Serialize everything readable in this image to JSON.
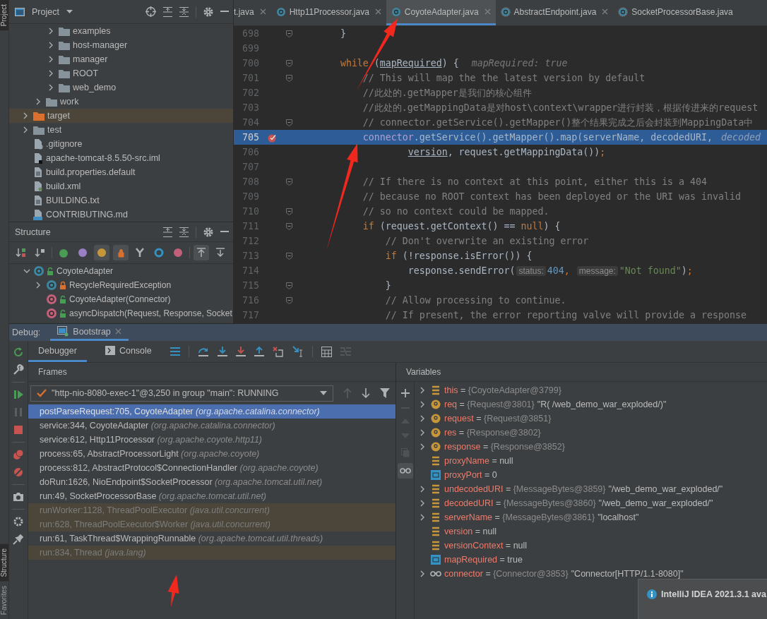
{
  "tool_stripes": {
    "top": [
      {
        "label": "Project",
        "selected": true
      }
    ],
    "bottom": [
      {
        "label": "Structure",
        "selected": true
      },
      {
        "label": "Favorites",
        "selected": false
      }
    ]
  },
  "project_panel": {
    "title": "Project",
    "tree": [
      {
        "children": [
          {
            "children": [
              {
                "label": "examples",
                "kind": "folder",
                "expanded": false,
                "selected": false
              },
              {
                "label": "host-manager",
                "kind": "folder",
                "expanded": false,
                "selected": false
              },
              {
                "label": "manager",
                "kind": "folder",
                "expanded": false,
                "selected": false
              },
              {
                "label": "ROOT",
                "kind": "folder",
                "expanded": false,
                "selected": false
              },
              {
                "label": "web_demo",
                "kind": "folder",
                "expanded": false,
                "selected": false
              }
            ]
          },
          {
            "label": "work",
            "kind": "folder",
            "expanded": false,
            "selected": false
          }
        ]
      },
      {
        "label": "target",
        "kind": "excluded-folder",
        "expanded": false,
        "selected": true
      },
      {
        "label": "test",
        "kind": "folder",
        "expanded": false,
        "selected": false
      },
      {
        "label": ".gitignore",
        "kind": "ignore-file",
        "selected": false
      },
      {
        "label": "apache-tomcat-8.5.50-src.iml",
        "kind": "module-file",
        "selected": false
      },
      {
        "label": "build.properties.default",
        "kind": "text-file",
        "selected": false
      },
      {
        "label": "build.xml",
        "kind": "xml-file",
        "selected": false
      },
      {
        "label": "BUILDING.txt",
        "kind": "text-file",
        "selected": false
      },
      {
        "label": "CONTRIBUTING.md",
        "kind": "markdown-file",
        "selected": false
      }
    ]
  },
  "structure_panel": {
    "title": "Structure",
    "toolbar": [
      {
        "kind": "sort-visibility",
        "on": false
      },
      {
        "kind": "sort-alpha",
        "on": false
      },
      {
        "kind": "inherited",
        "on": false
      },
      {
        "kind": "properties",
        "on": false
      },
      {
        "kind": "fields",
        "on": true
      },
      {
        "kind": "non-public",
        "on": true
      },
      {
        "kind": "fork",
        "on": false
      },
      {
        "kind": "anonymous",
        "on": false
      },
      {
        "kind": "lambdas",
        "on": false
      },
      {
        "kind": "autoscroll-to",
        "on": true
      },
      {
        "kind": "autoscroll-from",
        "on": false
      }
    ],
    "tree": [
      {
        "label": "CoyoteAdapter",
        "kind": "class",
        "private": false,
        "expanded": true,
        "children": [
          {
            "label": "RecycleRequiredException",
            "kind": "class",
            "private": true,
            "expanded": false
          },
          {
            "label": "CoyoteAdapter(Connector)",
            "kind": "method",
            "private": false
          },
          {
            "label": "asyncDispatch(Request, Response, Socket",
            "kind": "method",
            "private": false
          }
        ]
      }
    ]
  },
  "editor": {
    "tabs": [
      {
        "label": "t.java",
        "selected": false,
        "closable": true
      },
      {
        "label": "Http11Processor.java",
        "selected": false,
        "closable": true,
        "kind": "class"
      },
      {
        "label": "CoyoteAdapter.java",
        "selected": true,
        "closable": true,
        "kind": "class"
      },
      {
        "label": "AbstractEndpoint.java",
        "selected": false,
        "closable": true,
        "kind": "abstract-class"
      },
      {
        "label": "SocketProcessorBase.java",
        "selected": false,
        "closable": false,
        "kind": "abstract-class"
      }
    ],
    "lines": [
      {
        "number": "698",
        "fold": true,
        "breakpoint": false,
        "current": false,
        "tokens": [
          {
            "kind": "plain",
            "text": "        }"
          }
        ]
      },
      {
        "number": "699",
        "fold": false,
        "breakpoint": false,
        "current": false
      },
      {
        "number": "700",
        "fold": true,
        "breakpoint": false,
        "current": false,
        "tokens": [
          {
            "kind": "kw",
            "text": "        while"
          },
          {
            "kind": "plain",
            "text": " ("
          },
          {
            "kind": "var",
            "text": "mapRequired"
          },
          {
            "kind": "plain",
            "text": ") {"
          },
          {
            "kind": "inline",
            "text": "mapRequired: true"
          }
        ]
      },
      {
        "number": "701",
        "fold": true,
        "breakpoint": false,
        "current": false,
        "tokens": [
          {
            "kind": "comment",
            "text": "            // This will map the the latest version by default"
          }
        ]
      },
      {
        "number": "702",
        "fold": false,
        "breakpoint": false,
        "current": false,
        "tokens": [
          {
            "kind": "comment",
            "text": "            //此处的.getMapper是我们的核心组件"
          }
        ]
      },
      {
        "number": "703",
        "fold": false,
        "breakpoint": false,
        "current": false,
        "tokens": [
          {
            "kind": "comment",
            "text": "            //此处的.getMappingData是对host\\context\\wrapper进行封装，根据传进来的request"
          }
        ]
      },
      {
        "number": "704",
        "fold": true,
        "breakpoint": false,
        "current": false,
        "tokens": [
          {
            "kind": "comment",
            "text": "            // connector.getService().getMapper()整个结果完成之后会封装到MappingData中"
          }
        ]
      },
      {
        "number": "705",
        "fold": false,
        "breakpoint": true,
        "current": true,
        "tokens": [
          {
            "kind": "field",
            "text": "            connector"
          },
          {
            "kind": "plain",
            "text": ".getService().getMapper().map(serverName, decodedURI,"
          },
          {
            "kind": "inline",
            "text": "decoded"
          }
        ]
      },
      {
        "number": "706",
        "fold": false,
        "breakpoint": false,
        "current": false,
        "tokens": [
          {
            "kind": "var",
            "text": "                    version"
          },
          {
            "kind": "plain",
            "text": ", request.getMappingData())"
          },
          {
            "kind": "punct",
            "text": ";"
          }
        ]
      },
      {
        "number": "707",
        "fold": false,
        "breakpoint": false,
        "current": false
      },
      {
        "number": "708",
        "fold": true,
        "breakpoint": false,
        "current": false,
        "tokens": [
          {
            "kind": "comment",
            "text": "            // If there is no context at this point, either this is a 404"
          }
        ]
      },
      {
        "number": "709",
        "fold": false,
        "breakpoint": false,
        "current": false,
        "tokens": [
          {
            "kind": "comment",
            "text": "            // because no ROOT context has been deployed or the URI was invalid"
          }
        ]
      },
      {
        "number": "710",
        "fold": true,
        "breakpoint": false,
        "current": false,
        "tokens": [
          {
            "kind": "comment",
            "text": "            // so no context could be mapped."
          }
        ]
      },
      {
        "number": "711",
        "fold": true,
        "breakpoint": false,
        "current": false,
        "tokens": [
          {
            "kind": "kw",
            "text": "            if"
          },
          {
            "kind": "plain",
            "text": " (request.getContext() == "
          },
          {
            "kind": "kw",
            "text": "null"
          },
          {
            "kind": "plain",
            "text": ") {"
          }
        ]
      },
      {
        "number": "712",
        "fold": false,
        "breakpoint": false,
        "current": false,
        "tokens": [
          {
            "kind": "comment",
            "text": "                // Don't overwrite an existing error"
          }
        ]
      },
      {
        "number": "713",
        "fold": true,
        "breakpoint": false,
        "current": false,
        "tokens": [
          {
            "kind": "kw",
            "text": "                if"
          },
          {
            "kind": "plain",
            "text": " (!response.isError()) {"
          }
        ]
      },
      {
        "number": "714",
        "fold": false,
        "breakpoint": false,
        "current": false,
        "tokens": [
          {
            "kind": "plain",
            "text": "                    response.sendError("
          },
          {
            "kind": "hint",
            "text": "status:"
          },
          {
            "kind": "num",
            "text": "404"
          },
          {
            "kind": "punct",
            "text": ", "
          },
          {
            "kind": "hint",
            "text": "message:"
          },
          {
            "kind": "str",
            "text": "\"Not found\""
          },
          {
            "kind": "plain",
            "text": ")"
          },
          {
            "kind": "punct",
            "text": ";"
          }
        ]
      },
      {
        "number": "715",
        "fold": true,
        "breakpoint": false,
        "current": false,
        "tokens": [
          {
            "kind": "plain",
            "text": "                }"
          }
        ]
      },
      {
        "number": "716",
        "fold": true,
        "breakpoint": false,
        "current": false,
        "tokens": [
          {
            "kind": "comment",
            "text": "                // Allow processing to continue."
          }
        ]
      },
      {
        "number": "717",
        "fold": false,
        "breakpoint": false,
        "current": false,
        "tokens": [
          {
            "kind": "comment",
            "text": "                // If present, the error reporting valve will provide a response"
          }
        ]
      }
    ]
  },
  "debug": {
    "title": "Debug:",
    "session": "Bootstrap",
    "tabs": [
      {
        "label": "Debugger",
        "selected": true,
        "kind": "debugger"
      },
      {
        "label": "Console",
        "selected": false,
        "kind": "console"
      }
    ],
    "frames": {
      "title": "Frames",
      "thread": "\"http-nio-8080-exec-1\"@3,250 in group \"main\": RUNNING",
      "items": [
        {
          "method": "postParseRequest:705, CoyoteAdapter",
          "package": "(org.apache.catalina.connector)",
          "selected": true,
          "library": false
        },
        {
          "method": "service:344, CoyoteAdapter",
          "package": "(org.apache.catalina.connector)",
          "selected": false,
          "library": false
        },
        {
          "method": "service:612, Http11Processor",
          "package": "(org.apache.coyote.http11)",
          "selected": false,
          "library": false
        },
        {
          "method": "process:65, AbstractProcessorLight",
          "package": "(org.apache.coyote)",
          "selected": false,
          "library": false
        },
        {
          "method": "process:812, AbstractProtocol$ConnectionHandler",
          "package": "(org.apache.coyote)",
          "selected": false,
          "library": false
        },
        {
          "method": "doRun:1626, NioEndpoint$SocketProcessor",
          "package": "(org.apache.tomcat.util.net)",
          "selected": false,
          "library": false
        },
        {
          "method": "run:49, SocketProcessorBase",
          "package": "(org.apache.tomcat.util.net)",
          "selected": false,
          "library": false
        },
        {
          "method": "runWorker:1128, ThreadPoolExecutor",
          "package": "(java.util.concurrent)",
          "selected": false,
          "library": true
        },
        {
          "method": "run:628, ThreadPoolExecutor$Worker",
          "package": "(java.util.concurrent)",
          "selected": false,
          "library": true
        },
        {
          "method": "run:61, TaskThread$WrappingRunnable",
          "package": "(org.apache.tomcat.util.threads)",
          "selected": false,
          "library": false
        },
        {
          "method": "run:834, Thread",
          "package": "(java.lang)",
          "selected": false,
          "library": true
        }
      ]
    },
    "variables": {
      "title": "Variables",
      "items": [
        {
          "name": "this",
          "op": "=",
          "ref": "{CoyoteAdapter@3799}",
          "kind": "field",
          "has_children": true
        },
        {
          "name": "req",
          "op": "=",
          "ref": "{Request@3801}",
          "value": "\"R( /web_demo_war_exploded/)\"",
          "kind": "param",
          "has_children": true
        },
        {
          "name": "request",
          "op": "=",
          "ref": "{Request@3851}",
          "kind": "param",
          "has_children": true
        },
        {
          "name": "res",
          "op": "=",
          "ref": "{Response@3802}",
          "kind": "param",
          "has_children": true
        },
        {
          "name": "response",
          "op": "=",
          "ref": "{Response@3852}",
          "kind": "param",
          "has_children": true
        },
        {
          "name": "proxyName",
          "op": "=",
          "value": "null",
          "kind": "field",
          "has_children": false
        },
        {
          "name": "proxyPort",
          "op": "=",
          "value": "0",
          "kind": "primitive",
          "has_children": false
        },
        {
          "name": "undecodedURI",
          "op": "=",
          "ref": "{MessageBytes@3859}",
          "value": "\"/web_demo_war_exploded/\"",
          "kind": "field",
          "has_children": true
        },
        {
          "name": "decodedURI",
          "op": "=",
          "ref": "{MessageBytes@3860}",
          "value": "\"/web_demo_war_exploded/\"",
          "kind": "field",
          "has_children": true
        },
        {
          "name": "serverName",
          "op": "=",
          "ref": "{MessageBytes@3861}",
          "value": "\"localhost\"",
          "kind": "field",
          "has_children": true
        },
        {
          "name": "version",
          "op": "=",
          "value": "null",
          "kind": "field",
          "has_children": false
        },
        {
          "name": "versionContext",
          "op": "=",
          "value": "null",
          "kind": "field",
          "has_children": false
        },
        {
          "name": "mapRequired",
          "op": "=",
          "value": "true",
          "kind": "primitive",
          "has_children": false
        },
        {
          "name": "connector",
          "op": "=",
          "ref": "{Connector@3853}",
          "value": "\"Connector[HTTP/1.1-8080]\"",
          "kind": "watch",
          "has_children": true
        }
      ]
    }
  },
  "notification": {
    "title": "IntelliJ IDEA 2021.3.1 ava"
  }
}
